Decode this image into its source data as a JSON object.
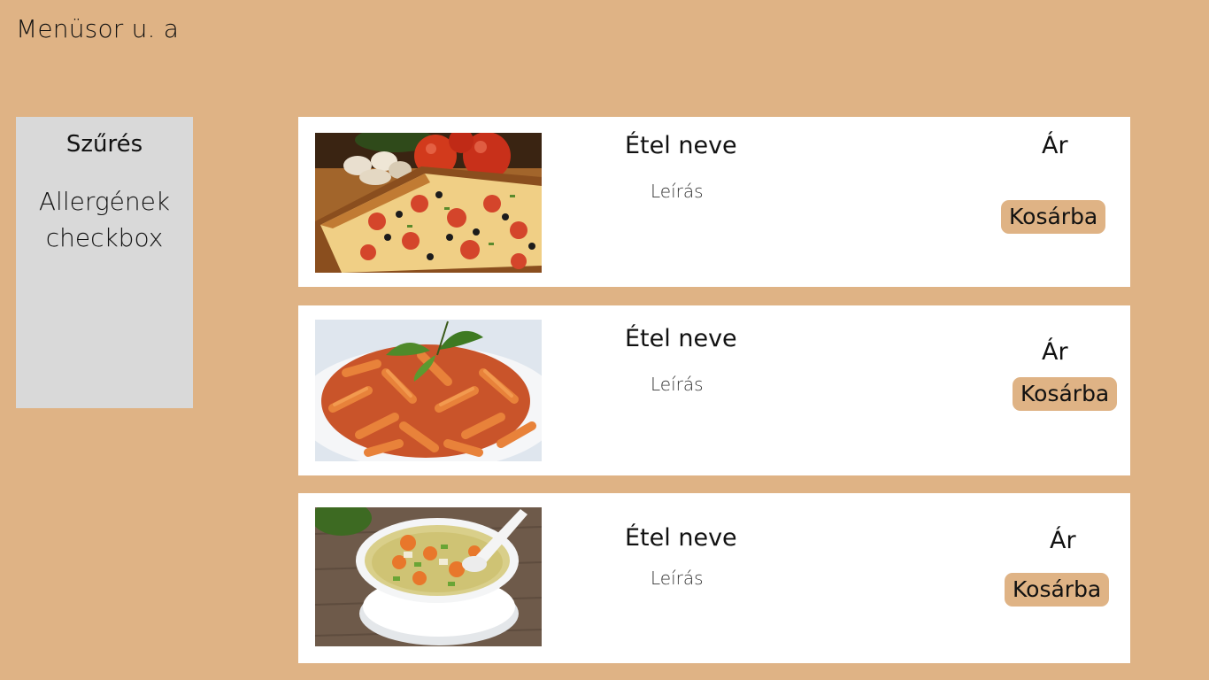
{
  "menubar": {
    "title": "Menüsor u. a"
  },
  "filter": {
    "title": "Szűrés",
    "allergens_line1": "Allergének",
    "allergens_line2": "checkbox"
  },
  "menu_items": [
    {
      "image_icon": "pizza-image",
      "name": "Étel neve",
      "description": "Leírás",
      "price": "Ár",
      "cart_label": "Kosárba"
    },
    {
      "image_icon": "pasta-image",
      "name": "Étel neve",
      "description": "Leírás",
      "price": "Ár",
      "cart_label": "Kosárba"
    },
    {
      "image_icon": "soup-image",
      "name": "Étel neve",
      "description": "Leírás",
      "price": "Ár",
      "cart_label": "Kosárba"
    }
  ],
  "colors": {
    "background": "#dfb385",
    "panel": "#d9d9d9",
    "card": "#ffffff",
    "button": "#dfb385"
  }
}
